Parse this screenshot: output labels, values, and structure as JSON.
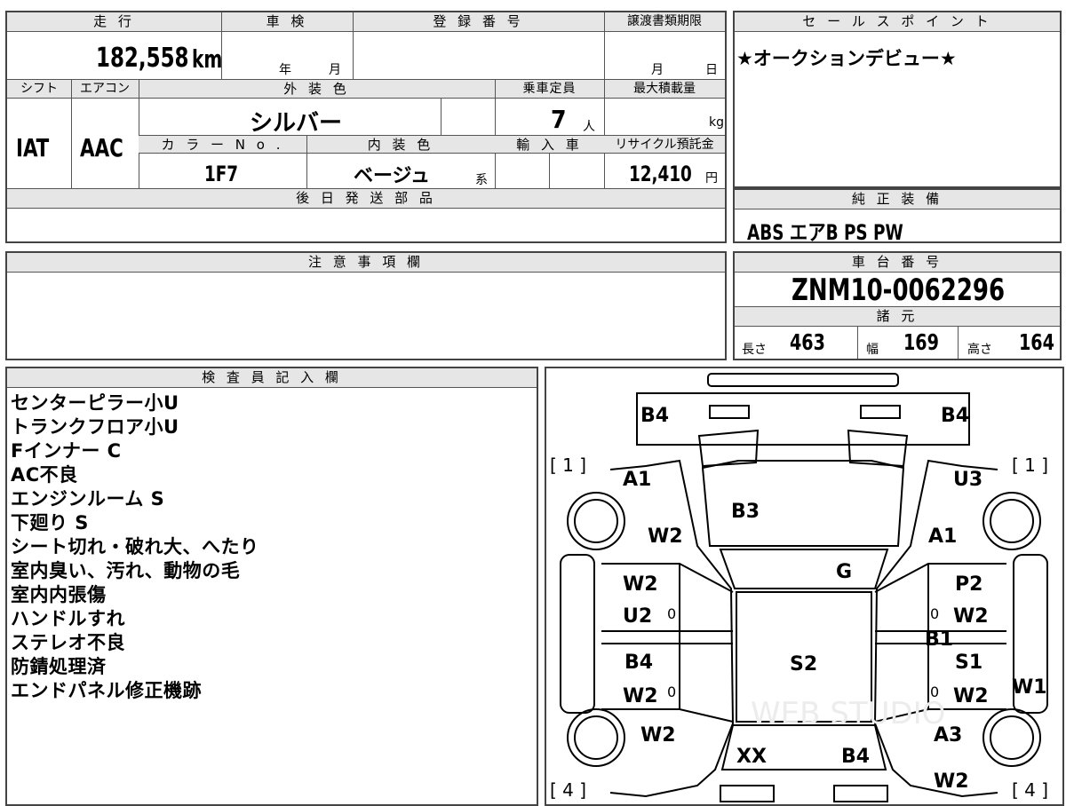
{
  "info": {
    "headers": {
      "mileage": "走 行",
      "inspection": "車 検",
      "registration": "登 録 番 号",
      "transfer_deadline": "譲渡書類期限",
      "shift": "シフト",
      "aircon": "エアコン",
      "exterior_color": "外 装 色",
      "capacity": "乗車定員",
      "max_load": "最大積載量",
      "color_no": "カ ラ ー N o .",
      "interior_color": "内 装 色",
      "import": "輸 入 車",
      "recycle": "リサイクル預託金",
      "later_parts": "後 日 発 送 部 品",
      "caution": "注 意 事 項 欄"
    },
    "mileage_value": "182,558",
    "mileage_unit": "km",
    "year_unit": "年",
    "month_unit": "月",
    "deadline_month": "月",
    "deadline_day": "日",
    "shift_value": "IAT",
    "aircon_value": "AAC",
    "exterior_color_value": "シルバー",
    "capacity_value": "7",
    "capacity_unit": "人",
    "max_load_unit": "kg",
    "color_no_value": "1F7",
    "interior_color_value": "ベージュ",
    "interior_suffix": "系",
    "recycle_value": "12,410",
    "recycle_unit": "円"
  },
  "sales": {
    "header": "セ ー ル ス ポ イ ン ト",
    "point": "★オークションデビュー★"
  },
  "equipment": {
    "header": "純 正 装 備",
    "items": "ABS エアB PS PW"
  },
  "chassis": {
    "header": "車 台 番 号",
    "number": "ZNM10-0062296"
  },
  "specs": {
    "header": "諸 元",
    "length_label": "長さ",
    "length": "463",
    "width_label": "幅",
    "width": "169",
    "height_label": "高さ",
    "height": "164"
  },
  "inspector": {
    "header": "検 査 員 記 入 欄",
    "notes": [
      "センターピラー小U",
      "トランクフロア小U",
      "Fインナー C",
      "AC不良",
      "エンジンルーム S",
      "下廻り S",
      "シート切れ・破れ大、へたり",
      "室内臭い、汚れ、動物の毛",
      "室内内張傷",
      "ハンドルすれ",
      "ステレオ不良",
      "防錆処理済",
      "エンドパネル修正機跡"
    ]
  },
  "diagram": {
    "tire_left_top": "[ 1 ]",
    "tire_right_top": "[ 1 ]",
    "tire_left_bottom": "[ 4 ]",
    "tire_right_bottom": "[ 4 ]",
    "marks": {
      "b4_top_left": "B4",
      "b4_top_right": "B4",
      "a1_left": "A1",
      "u3_right": "U3",
      "b3_hood": "B3",
      "w2_left_fender": "W2",
      "a1_right_fender": "A1",
      "g_windshield": "G",
      "w2_left_front_door": "W2",
      "u2_left_front_door": "U2",
      "p2_right_front_door": "P2",
      "w2_right_front_door": "W2",
      "b1_right_pillar": "B1",
      "s2_roof": "S2",
      "b4_left_rear_door": "B4",
      "w2_left_rear_door": "W2",
      "s1_right_rear_door": "S1",
      "w2_right_rear_door": "W2",
      "w1_right_side": "W1",
      "w2_left_quarter": "W2",
      "a3_right_quarter": "A3",
      "xx_rear_glass": "XX",
      "b4_trunk": "B4",
      "w2_right_rear": "W2"
    },
    "zero": "0",
    "watermark": "WEB STUDIO"
  }
}
